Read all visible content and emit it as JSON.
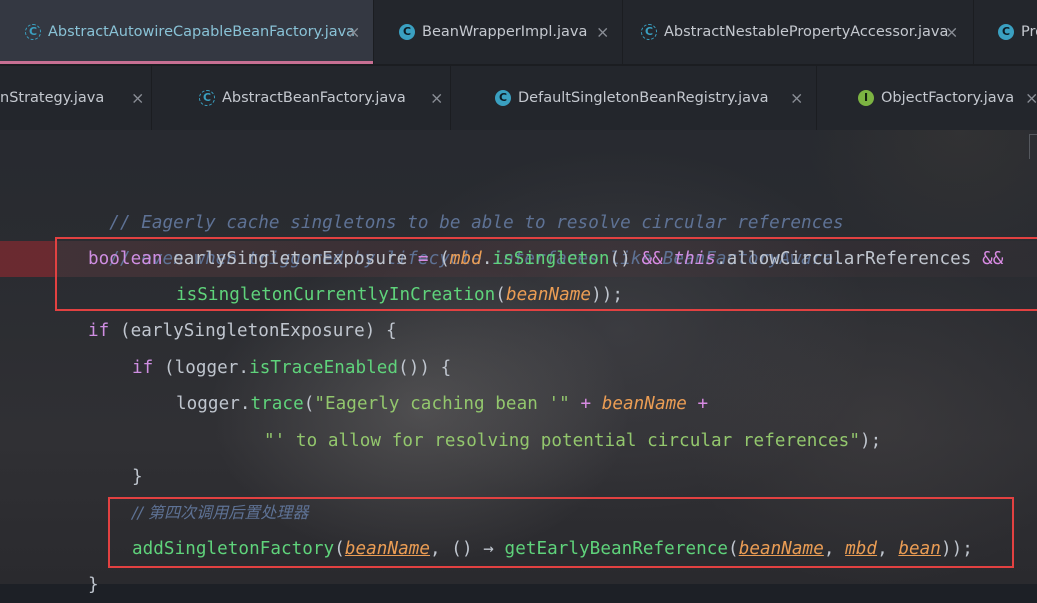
{
  "tabs_row1": [
    {
      "label": "AbstractAutowireCapableBeanFactory.java",
      "icon": "class-icon",
      "active": true
    },
    {
      "label": "BeanWrapperImpl.java",
      "icon": "class-icon"
    },
    {
      "label": "AbstractNestablePropertyAccessor.java",
      "icon": "abstract-class-icon"
    },
    {
      "label": "Pro",
      "icon": "class-icon"
    }
  ],
  "tabs_row2": [
    {
      "label": "nStrategy.java"
    },
    {
      "label": "AbstractBeanFactory.java",
      "icon": "abstract-class-icon"
    },
    {
      "label": "DefaultSingletonBeanRegistry.java",
      "icon": "class-icon"
    },
    {
      "label": "ObjectFactory.java",
      "icon": "interface-icon"
    }
  ],
  "close_glyph": "×",
  "colors": {
    "accent": "#c76f93",
    "highlight_box": "#e24141",
    "keyword": "#cf8ee2",
    "method": "#5fd37b",
    "param": "#eb9d54",
    "comment": "#5e7295",
    "string": "#93c76d"
  },
  "code": {
    "l1": {
      "t0": "// Eagerly cache singletons to be able to resolve circular references"
    },
    "l2": {
      "t0": "// even when triggered by lifecycle interfaces like BeanFactoryAware."
    },
    "l3": {
      "t0": "boolean",
      "t1": " earlySingletonExposure ",
      "t2": "=",
      "t3": " (",
      "t4": "mbd",
      "t5": ".",
      "t6": "isSingleton",
      "t7": "() ",
      "t8": "&&",
      "t9": " ",
      "t10": "this",
      "t11": ".allowCircularReferences ",
      "t12": "&&"
    },
    "l4": {
      "t0": "isSingletonCurrentlyInCreation",
      "t1": "(",
      "t2": "beanName",
      "t3": "));"
    },
    "l5": {
      "t0": "if",
      "t1": " (earlySingletonExposure) {"
    },
    "l6": {
      "t0": "if",
      "t1": " (logger.",
      "t2": "isTraceEnabled",
      "t3": "()) {"
    },
    "l7": {
      "t0": "logger.",
      "t1": "trace",
      "t2": "(",
      "t3": "\"Eagerly caching bean '\"",
      "t4": " + ",
      "t5": "beanName",
      "t6": " +"
    },
    "l8": {
      "t0": "\"' to allow for resolving potential circular references\"",
      "t1": ");"
    },
    "l9": {
      "t0": "}"
    },
    "l10": {
      "t0": "// 第四次调用后置处理器"
    },
    "l11": {
      "t0": "addSingletonFactory",
      "t1": "(",
      "t2": "beanName",
      "t3": ", () ",
      "t4": "→",
      "t5": " ",
      "t6": "getEarlyBeanReference",
      "t7": "(",
      "t8": "beanName",
      "t9": ", ",
      "t10": "mbd",
      "t11": ", ",
      "t12": "bean",
      "t13": "));"
    },
    "l12": {
      "t0": "}"
    }
  }
}
